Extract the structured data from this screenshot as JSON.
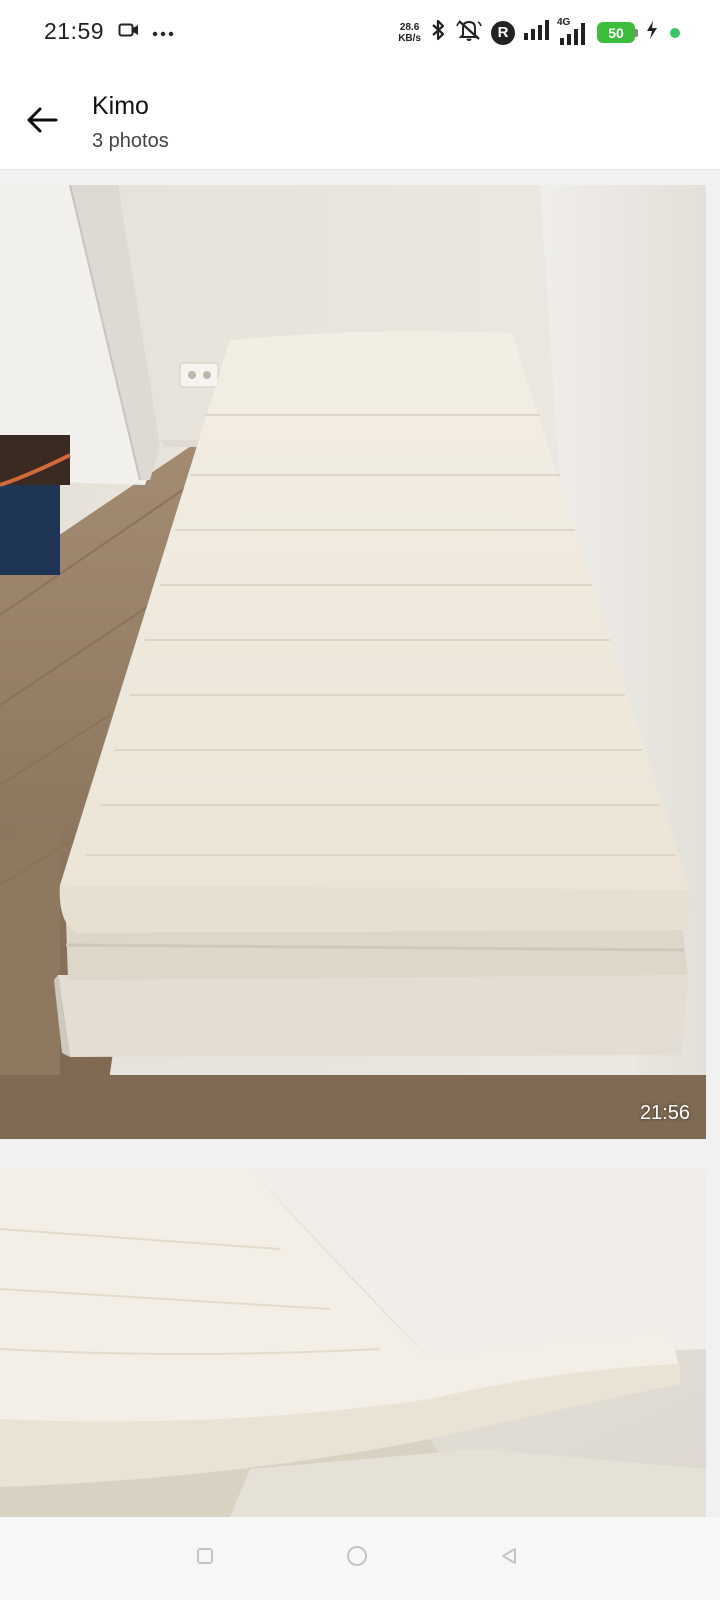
{
  "status_bar": {
    "time": "21:59",
    "left_icons": [
      "video-call-icon",
      "more-dots-icon"
    ],
    "network_speed_value": "28.6",
    "network_speed_unit": "KB/s",
    "network_type": "4G",
    "roaming_badge": "R",
    "battery_level": "50",
    "right_icons": [
      "bluetooth-icon",
      "notifications-muted-icon",
      "signal-icon",
      "signal-4g-icon",
      "charging-icon"
    ],
    "colors": {
      "battery": "#3dbe3a",
      "dot": "#39c36b"
    }
  },
  "header": {
    "title": "Kimo",
    "subtitle": "3 photos",
    "back_icon": "arrow-left-icon"
  },
  "photos": [
    {
      "description_icon": "photo",
      "timestamp": "21:56"
    },
    {
      "description_icon": "photo",
      "timestamp": ""
    }
  ],
  "nav_bar": {
    "icons": [
      "recents-square-icon",
      "home-circle-icon",
      "back-triangle-icon"
    ]
  }
}
